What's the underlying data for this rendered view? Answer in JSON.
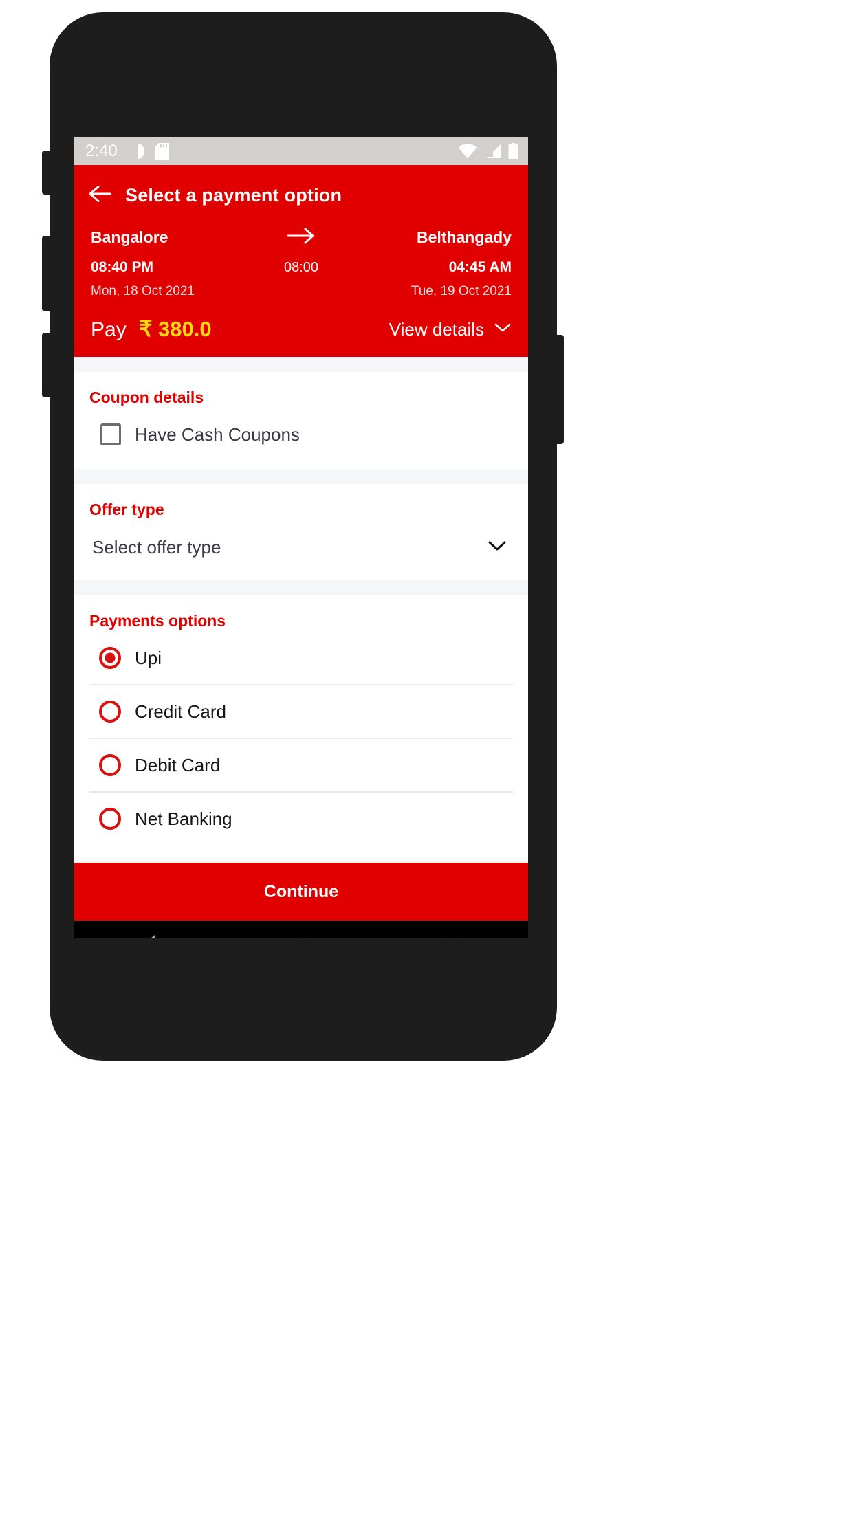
{
  "statusbar": {
    "time": "2:40",
    "left_icons": [
      "do-not-disturb-icon",
      "sd-card-icon"
    ],
    "right_icons": [
      "wifi-icon",
      "cellular-signal-icon",
      "battery-icon"
    ]
  },
  "appbar": {
    "back_icon": "back-arrow-icon",
    "title": "Select a payment option"
  },
  "journey": {
    "origin": "Bangalore",
    "destination": "Belthangady",
    "arrow_icon": "arrow-right-icon",
    "departure_time": "08:40 PM",
    "arrival_time": "04:45 AM",
    "duration": "08:00",
    "departure_date": "Mon, 18 Oct 2021",
    "arrival_date": "Tue, 19 Oct 2021",
    "pay_label": "Pay",
    "pay_amount": "₹ 380.0",
    "view_details_label": "View details",
    "view_details_icon": "chevron-down-icon"
  },
  "coupon": {
    "title": "Coupon details",
    "checkbox_label": "Have Cash Coupons",
    "checked": false
  },
  "offer": {
    "title": "Offer type",
    "selected_value": "Select offer type",
    "dropdown_icon": "chevron-down-icon"
  },
  "payments": {
    "title": "Payments options",
    "options": [
      {
        "label": "Upi",
        "selected": true
      },
      {
        "label": "Credit Card",
        "selected": false
      },
      {
        "label": "Debit Card",
        "selected": false
      },
      {
        "label": "Net Banking",
        "selected": false
      }
    ]
  },
  "footer": {
    "continue_label": "Continue"
  },
  "navbar": {
    "back": "nav-back-icon",
    "home": "nav-home-icon",
    "recents": "nav-recents-icon"
  },
  "colors": {
    "brand_red": "#e10000",
    "accent_yellow": "#ffd814",
    "section_heading_red": "#e00000"
  }
}
